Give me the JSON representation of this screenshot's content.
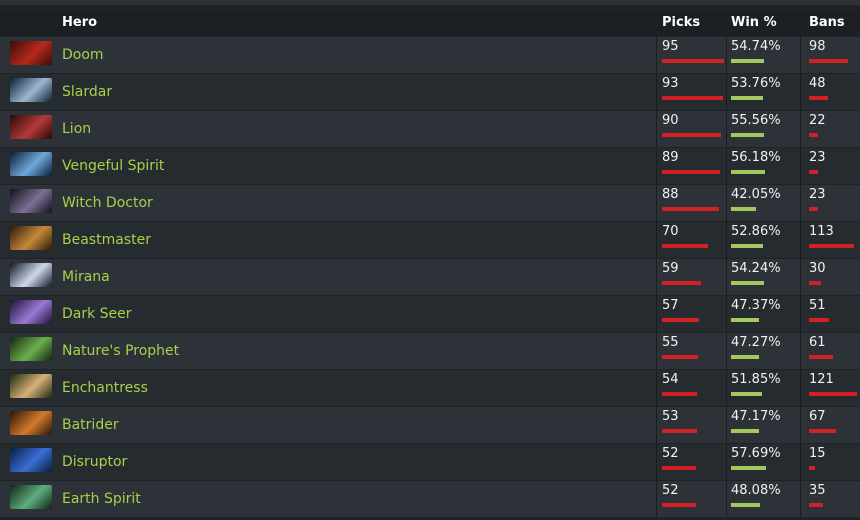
{
  "columns": {
    "hero": "Hero",
    "picks": "Picks",
    "win": "Win %",
    "bans": "Bans"
  },
  "colors": {
    "hero_name": "#a7d14a",
    "picks_bar": "#d32025",
    "win_bar": "#a3c95d",
    "bans_bar": "#d32025"
  },
  "rows": [
    {
      "hero": "Doom",
      "picks": "95",
      "win": "54.74%",
      "bans": "98",
      "win_value": 54.74,
      "icon_colors": [
        "#3b0b0b",
        "#b52a1b"
      ]
    },
    {
      "hero": "Slardar",
      "picks": "93",
      "win": "53.76%",
      "bans": "48",
      "win_value": 53.76,
      "icon_colors": [
        "#0d2030",
        "#9db6d1"
      ]
    },
    {
      "hero": "Lion",
      "picks": "90",
      "win": "55.56%",
      "bans": "22",
      "win_value": 55.56,
      "icon_colors": [
        "#2a0808",
        "#b53a3a"
      ]
    },
    {
      "hero": "Vengeful Spirit",
      "picks": "89",
      "win": "56.18%",
      "bans": "23",
      "win_value": 56.18,
      "icon_colors": [
        "#0b1d33",
        "#6ea8d9"
      ]
    },
    {
      "hero": "Witch Doctor",
      "picks": "88",
      "win": "42.05%",
      "bans": "23",
      "win_value": 42.05,
      "icon_colors": [
        "#120f1a",
        "#7b6f95"
      ]
    },
    {
      "hero": "Beastmaster",
      "picks": "70",
      "win": "52.86%",
      "bans": "113",
      "win_value": 52.86,
      "icon_colors": [
        "#2b1a06",
        "#c4893a"
      ]
    },
    {
      "hero": "Mirana",
      "picks": "59",
      "win": "54.24%",
      "bans": "30",
      "win_value": 54.24,
      "icon_colors": [
        "#101826",
        "#cfd9ea"
      ]
    },
    {
      "hero": "Dark Seer",
      "picks": "57",
      "win": "47.37%",
      "bans": "51",
      "win_value": 47.37,
      "icon_colors": [
        "#1c1230",
        "#9b78d6"
      ]
    },
    {
      "hero": "Nature's Prophet",
      "picks": "55",
      "win": "47.27%",
      "bans": "61",
      "win_value": 47.27,
      "icon_colors": [
        "#14250d",
        "#6bb04d"
      ]
    },
    {
      "hero": "Enchantress",
      "picks": "54",
      "win": "51.85%",
      "bans": "121",
      "win_value": 51.85,
      "icon_colors": [
        "#1d2a0b",
        "#d7b07a"
      ]
    },
    {
      "hero": "Batrider",
      "picks": "53",
      "win": "47.17%",
      "bans": "67",
      "win_value": 47.17,
      "icon_colors": [
        "#2c1305",
        "#d27a2a"
      ]
    },
    {
      "hero": "Disruptor",
      "picks": "52",
      "win": "57.69%",
      "bans": "15",
      "win_value": 57.69,
      "icon_colors": [
        "#0b1d3a",
        "#3a6fd8"
      ]
    },
    {
      "hero": "Earth Spirit",
      "picks": "52",
      "win": "48.08%",
      "bans": "35",
      "win_value": 48.08,
      "icon_colors": [
        "#102317",
        "#5fae7e"
      ]
    }
  ]
}
